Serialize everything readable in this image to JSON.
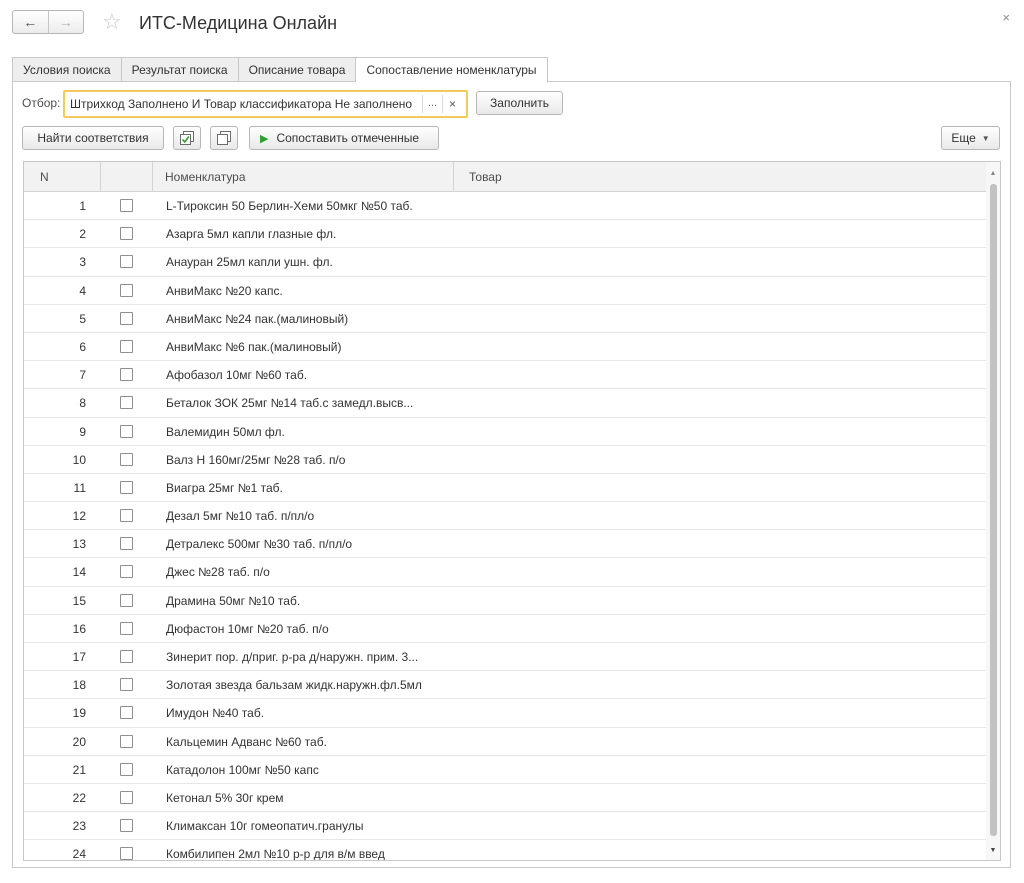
{
  "window": {
    "title": "ИТС-Медицина Онлайн",
    "back_icon": "←",
    "forward_icon": "→",
    "star_icon": "☆",
    "close_icon": "×"
  },
  "tabs": [
    {
      "label": "Условия поиска",
      "active": false
    },
    {
      "label": "Результат поиска",
      "active": false
    },
    {
      "label": "Описание товара",
      "active": false
    },
    {
      "label": "Сопоставление номенклатуры",
      "active": true
    }
  ],
  "filter": {
    "label": "Отбор:",
    "value": "Штрихкод Заполнено И Товар классификатора Не заполнено",
    "dots": "...",
    "clear": "×",
    "fill_button": "Заполнить"
  },
  "toolbar": {
    "find_button": "Найти соответствия",
    "match_button": "Сопоставить отмеченные",
    "more_button": "Еще"
  },
  "table": {
    "columns": [
      "N",
      "",
      "Номенклатура",
      "Товар"
    ],
    "rows": [
      {
        "n": "1",
        "name": "L-Тироксин 50 Берлин-Хеми 50мкг №50 таб.",
        "product": ""
      },
      {
        "n": "2",
        "name": "Азарга 5мл капли глазные фл.",
        "product": ""
      },
      {
        "n": "3",
        "name": "Анауран 25мл капли ушн. фл.",
        "product": ""
      },
      {
        "n": "4",
        "name": "АнвиМакс №20 капс.",
        "product": ""
      },
      {
        "n": "5",
        "name": "АнвиМакс №24 пак.(малиновый)",
        "product": ""
      },
      {
        "n": "6",
        "name": "АнвиМакс №6 пак.(малиновый)",
        "product": ""
      },
      {
        "n": "7",
        "name": "Афобазол 10мг №60 таб.",
        "product": ""
      },
      {
        "n": "8",
        "name": "Беталок ЗОК 25мг №14  таб.с замедл.высв...",
        "product": ""
      },
      {
        "n": "9",
        "name": "Валемидин 50мл фл.",
        "product": ""
      },
      {
        "n": "10",
        "name": "Валз Н 160мг/25мг №28 таб. п/о",
        "product": ""
      },
      {
        "n": "11",
        "name": "Виагра 25мг №1 таб.",
        "product": ""
      },
      {
        "n": "12",
        "name": "Дезал 5мг №10 таб. п/пл/о",
        "product": ""
      },
      {
        "n": "13",
        "name": "Детралекс 500мг №30 таб. п/пл/о",
        "product": ""
      },
      {
        "n": "14",
        "name": "Джес №28 таб. п/о",
        "product": ""
      },
      {
        "n": "15",
        "name": "Драмина 50мг №10 таб.",
        "product": ""
      },
      {
        "n": "16",
        "name": "Дюфастон 10мг №20 таб. п/о",
        "product": ""
      },
      {
        "n": "17",
        "name": "Зинерит пор. д/приг. р-ра д/наружн. прим. 3...",
        "product": ""
      },
      {
        "n": "18",
        "name": "Золотая звезда бальзам жидк.наружн.фл.5мл",
        "product": ""
      },
      {
        "n": "19",
        "name": "Имудон №40 таб.",
        "product": ""
      },
      {
        "n": "20",
        "name": "Кальцемин Адванс №60 таб.",
        "product": ""
      },
      {
        "n": "21",
        "name": "Катадолон 100мг №50 капс",
        "product": ""
      },
      {
        "n": "22",
        "name": "Кетонал 5% 30г крем",
        "product": ""
      },
      {
        "n": "23",
        "name": "Климаксан 10г гомеопатич.гранулы",
        "product": ""
      },
      {
        "n": "24",
        "name": "Комбилипен 2мл №10 р-р для в/м введ",
        "product": ""
      }
    ]
  }
}
